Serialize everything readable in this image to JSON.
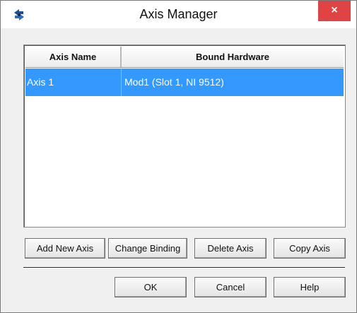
{
  "window": {
    "title": "Axis Manager",
    "close_label": "×"
  },
  "list": {
    "columns": [
      "Axis Name",
      "Bound Hardware"
    ],
    "rows": [
      {
        "name": "Axis 1",
        "hardware": "Mod1 (Slot 1, NI 9512)",
        "selected": true
      }
    ]
  },
  "buttons": {
    "add_new_axis": "Add New Axis",
    "change_binding": "Change Binding",
    "delete_axis": "Delete Axis",
    "copy_axis": "Copy Axis",
    "ok": "OK",
    "cancel": "Cancel",
    "help": "Help"
  },
  "colors": {
    "selection": "#3399ff",
    "close_button": "#e04343"
  },
  "icons": {
    "app": "axis-manager-app-icon",
    "close": "close-icon"
  }
}
